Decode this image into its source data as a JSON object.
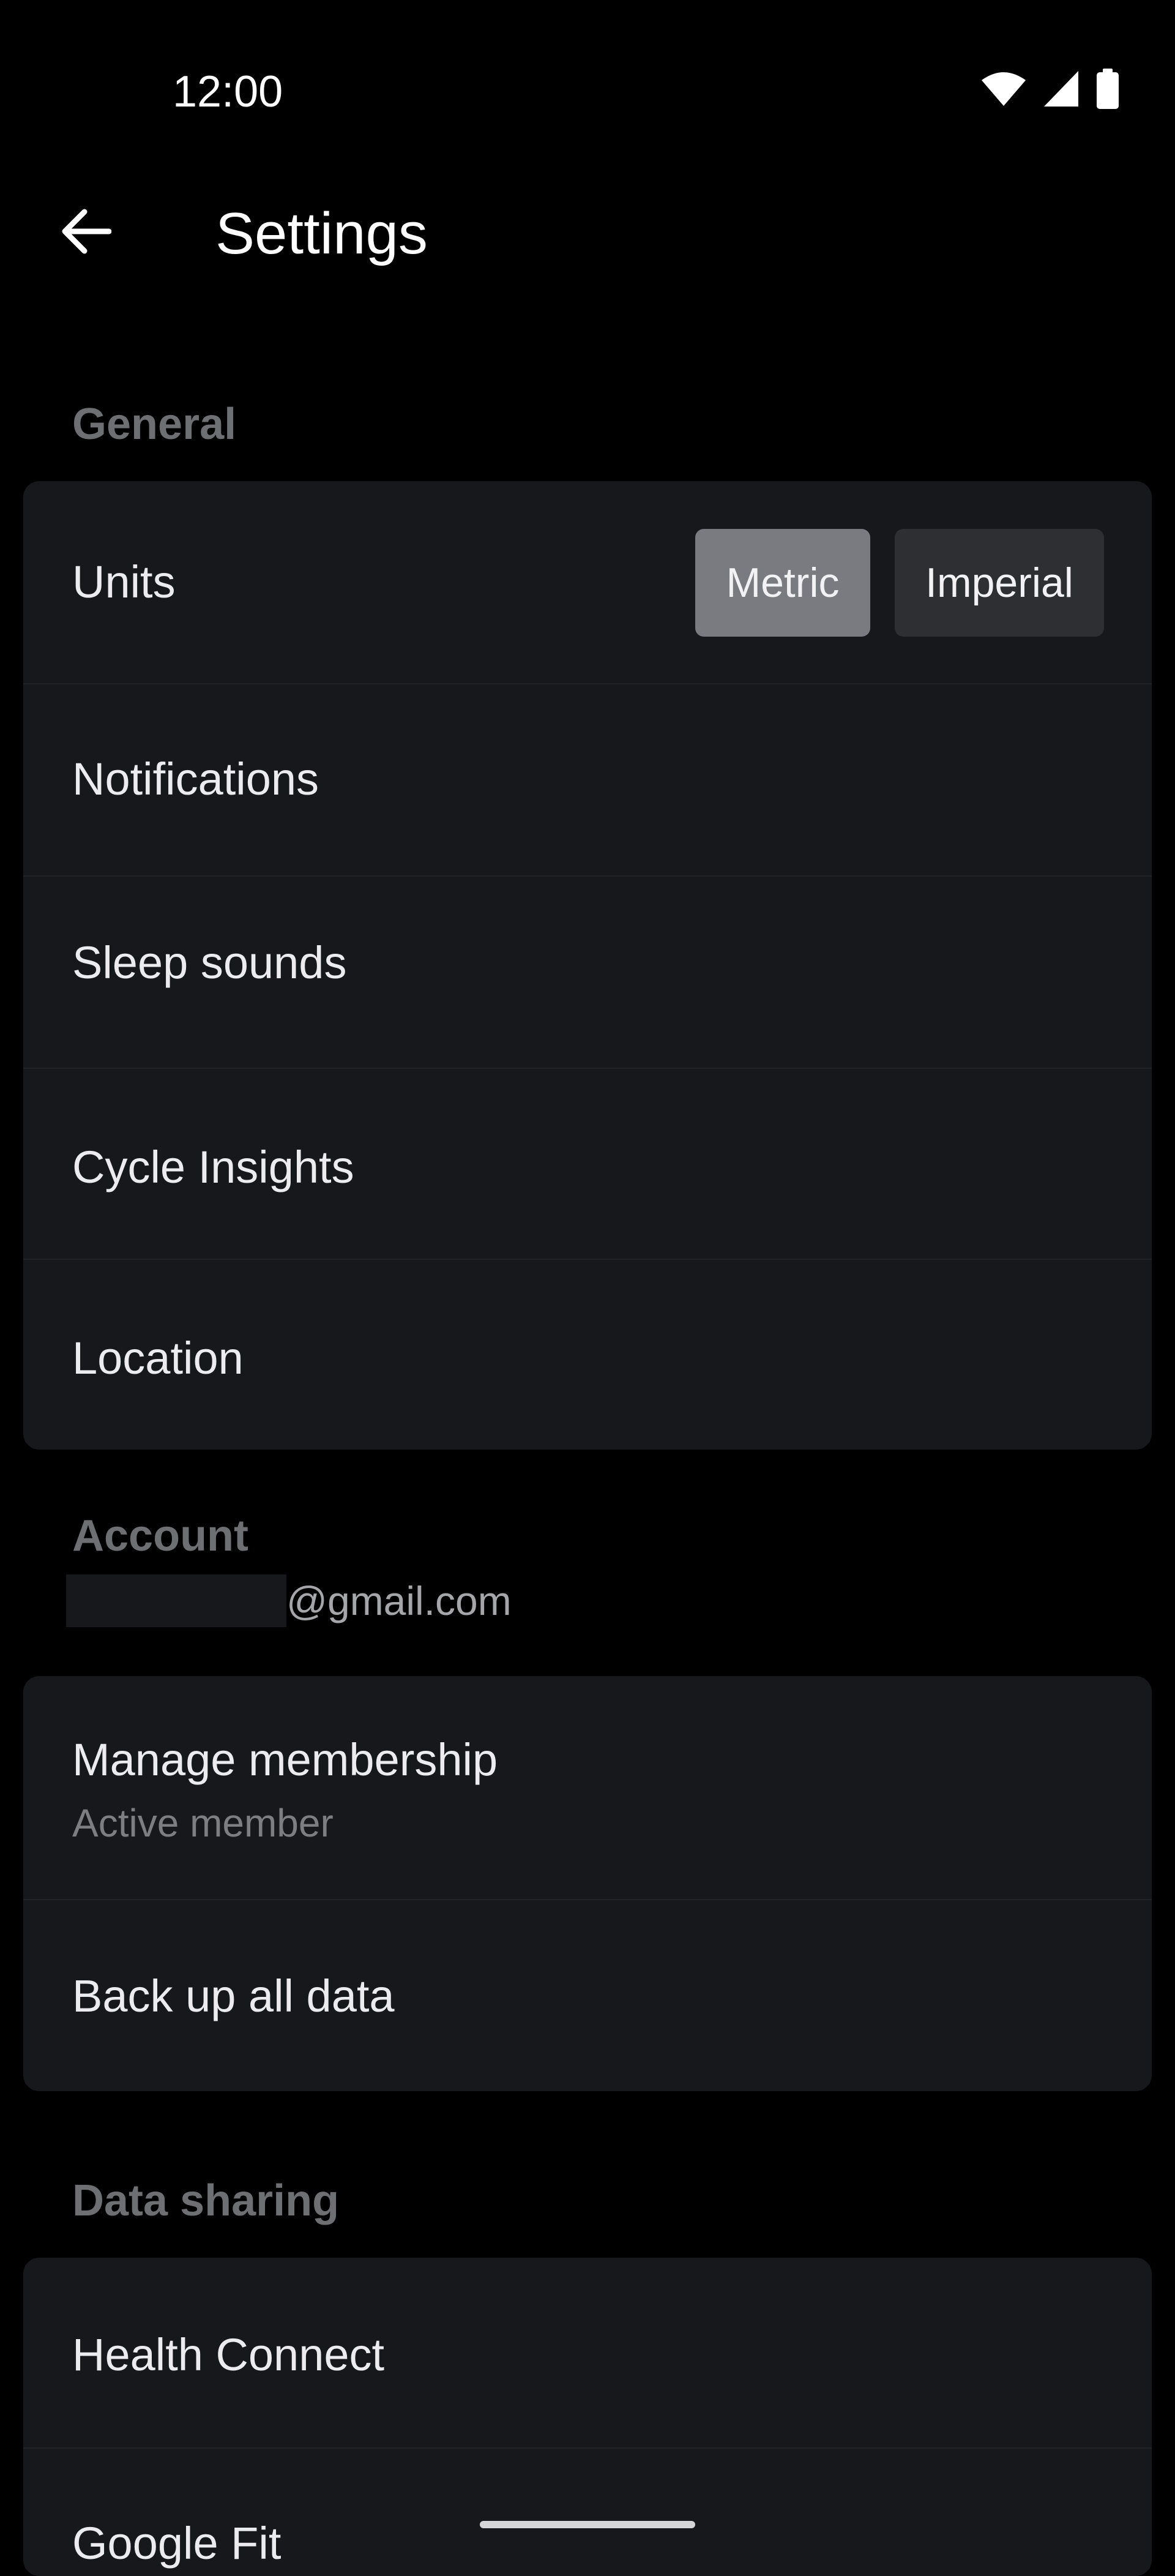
{
  "status_bar": {
    "time": "12:00",
    "icons": [
      "wifi-icon",
      "cellular-signal-icon",
      "battery-icon"
    ]
  },
  "app_bar": {
    "back_icon": "arrow-left-icon",
    "title": "Settings"
  },
  "sections": {
    "general": {
      "header": "General",
      "units": {
        "label": "Units",
        "options": [
          "Metric",
          "Imperial"
        ],
        "selected": "Metric"
      },
      "items": [
        "Notifications",
        "Sleep sounds",
        "Cycle Insights",
        "Location"
      ]
    },
    "account": {
      "header": "Account",
      "email_suffix": "@gmail.com",
      "manage_membership": {
        "label": "Manage membership",
        "subtitle": "Active member"
      },
      "backup": {
        "label": "Back up all data"
      }
    },
    "data_sharing": {
      "header": "Data sharing",
      "items": [
        "Health Connect",
        "Google Fit"
      ]
    }
  },
  "colors": {
    "background": "#000000",
    "card": "#17181C",
    "divider": "#232428",
    "section_header": "#6E6F73",
    "segment_selected": "#7A7B80",
    "segment_unselected": "#2E2F33",
    "text_primary": "#ECECEE",
    "text_secondary": "#7D7E82"
  }
}
